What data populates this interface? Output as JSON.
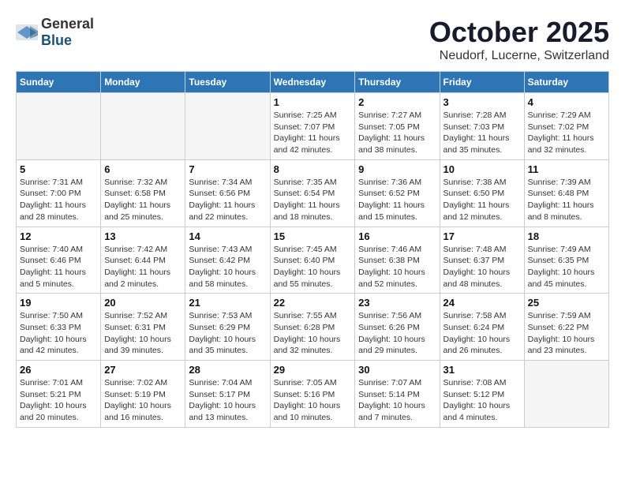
{
  "header": {
    "logo_general": "General",
    "logo_blue": "Blue",
    "month": "October 2025",
    "location": "Neudorf, Lucerne, Switzerland"
  },
  "weekdays": [
    "Sunday",
    "Monday",
    "Tuesday",
    "Wednesday",
    "Thursday",
    "Friday",
    "Saturday"
  ],
  "weeks": [
    [
      {
        "day": "",
        "info": ""
      },
      {
        "day": "",
        "info": ""
      },
      {
        "day": "",
        "info": ""
      },
      {
        "day": "1",
        "info": "Sunrise: 7:25 AM\nSunset: 7:07 PM\nDaylight: 11 hours\nand 42 minutes."
      },
      {
        "day": "2",
        "info": "Sunrise: 7:27 AM\nSunset: 7:05 PM\nDaylight: 11 hours\nand 38 minutes."
      },
      {
        "day": "3",
        "info": "Sunrise: 7:28 AM\nSunset: 7:03 PM\nDaylight: 11 hours\nand 35 minutes."
      },
      {
        "day": "4",
        "info": "Sunrise: 7:29 AM\nSunset: 7:02 PM\nDaylight: 11 hours\nand 32 minutes."
      }
    ],
    [
      {
        "day": "5",
        "info": "Sunrise: 7:31 AM\nSunset: 7:00 PM\nDaylight: 11 hours\nand 28 minutes."
      },
      {
        "day": "6",
        "info": "Sunrise: 7:32 AM\nSunset: 6:58 PM\nDaylight: 11 hours\nand 25 minutes."
      },
      {
        "day": "7",
        "info": "Sunrise: 7:34 AM\nSunset: 6:56 PM\nDaylight: 11 hours\nand 22 minutes."
      },
      {
        "day": "8",
        "info": "Sunrise: 7:35 AM\nSunset: 6:54 PM\nDaylight: 11 hours\nand 18 minutes."
      },
      {
        "day": "9",
        "info": "Sunrise: 7:36 AM\nSunset: 6:52 PM\nDaylight: 11 hours\nand 15 minutes."
      },
      {
        "day": "10",
        "info": "Sunrise: 7:38 AM\nSunset: 6:50 PM\nDaylight: 11 hours\nand 12 minutes."
      },
      {
        "day": "11",
        "info": "Sunrise: 7:39 AM\nSunset: 6:48 PM\nDaylight: 11 hours\nand 8 minutes."
      }
    ],
    [
      {
        "day": "12",
        "info": "Sunrise: 7:40 AM\nSunset: 6:46 PM\nDaylight: 11 hours\nand 5 minutes."
      },
      {
        "day": "13",
        "info": "Sunrise: 7:42 AM\nSunset: 6:44 PM\nDaylight: 11 hours\nand 2 minutes."
      },
      {
        "day": "14",
        "info": "Sunrise: 7:43 AM\nSunset: 6:42 PM\nDaylight: 10 hours\nand 58 minutes."
      },
      {
        "day": "15",
        "info": "Sunrise: 7:45 AM\nSunset: 6:40 PM\nDaylight: 10 hours\nand 55 minutes."
      },
      {
        "day": "16",
        "info": "Sunrise: 7:46 AM\nSunset: 6:38 PM\nDaylight: 10 hours\nand 52 minutes."
      },
      {
        "day": "17",
        "info": "Sunrise: 7:48 AM\nSunset: 6:37 PM\nDaylight: 10 hours\nand 48 minutes."
      },
      {
        "day": "18",
        "info": "Sunrise: 7:49 AM\nSunset: 6:35 PM\nDaylight: 10 hours\nand 45 minutes."
      }
    ],
    [
      {
        "day": "19",
        "info": "Sunrise: 7:50 AM\nSunset: 6:33 PM\nDaylight: 10 hours\nand 42 minutes."
      },
      {
        "day": "20",
        "info": "Sunrise: 7:52 AM\nSunset: 6:31 PM\nDaylight: 10 hours\nand 39 minutes."
      },
      {
        "day": "21",
        "info": "Sunrise: 7:53 AM\nSunset: 6:29 PM\nDaylight: 10 hours\nand 35 minutes."
      },
      {
        "day": "22",
        "info": "Sunrise: 7:55 AM\nSunset: 6:28 PM\nDaylight: 10 hours\nand 32 minutes."
      },
      {
        "day": "23",
        "info": "Sunrise: 7:56 AM\nSunset: 6:26 PM\nDaylight: 10 hours\nand 29 minutes."
      },
      {
        "day": "24",
        "info": "Sunrise: 7:58 AM\nSunset: 6:24 PM\nDaylight: 10 hours\nand 26 minutes."
      },
      {
        "day": "25",
        "info": "Sunrise: 7:59 AM\nSunset: 6:22 PM\nDaylight: 10 hours\nand 23 minutes."
      }
    ],
    [
      {
        "day": "26",
        "info": "Sunrise: 7:01 AM\nSunset: 5:21 PM\nDaylight: 10 hours\nand 20 minutes."
      },
      {
        "day": "27",
        "info": "Sunrise: 7:02 AM\nSunset: 5:19 PM\nDaylight: 10 hours\nand 16 minutes."
      },
      {
        "day": "28",
        "info": "Sunrise: 7:04 AM\nSunset: 5:17 PM\nDaylight: 10 hours\nand 13 minutes."
      },
      {
        "day": "29",
        "info": "Sunrise: 7:05 AM\nSunset: 5:16 PM\nDaylight: 10 hours\nand 10 minutes."
      },
      {
        "day": "30",
        "info": "Sunrise: 7:07 AM\nSunset: 5:14 PM\nDaylight: 10 hours\nand 7 minutes."
      },
      {
        "day": "31",
        "info": "Sunrise: 7:08 AM\nSunset: 5:12 PM\nDaylight: 10 hours\nand 4 minutes."
      },
      {
        "day": "",
        "info": ""
      }
    ]
  ]
}
